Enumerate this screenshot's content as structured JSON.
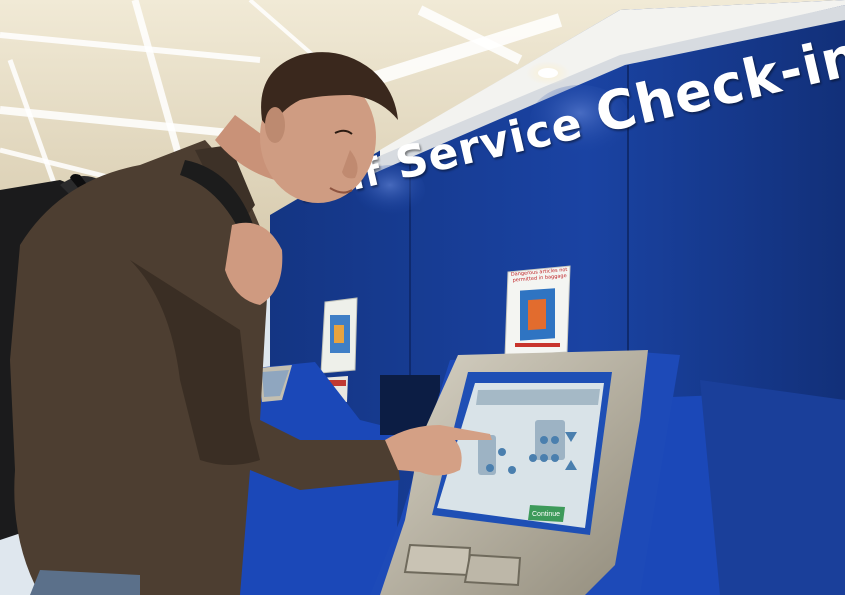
{
  "photo": {
    "sign_words": [
      "Self",
      "Service",
      "Check-in"
    ],
    "poster_right_title": "Dangerous articles not permitted in baggage",
    "kiosk_screen_button": "Continue",
    "colors": {
      "wall_blue": "#1a3f9a",
      "kiosk_blue": "#1b48b8",
      "ceiling": "#eae3cf",
      "jacket": "#4d3e31",
      "kiosk_frame": "#b8b2a2",
      "screen": "#d9e3e8"
    }
  }
}
